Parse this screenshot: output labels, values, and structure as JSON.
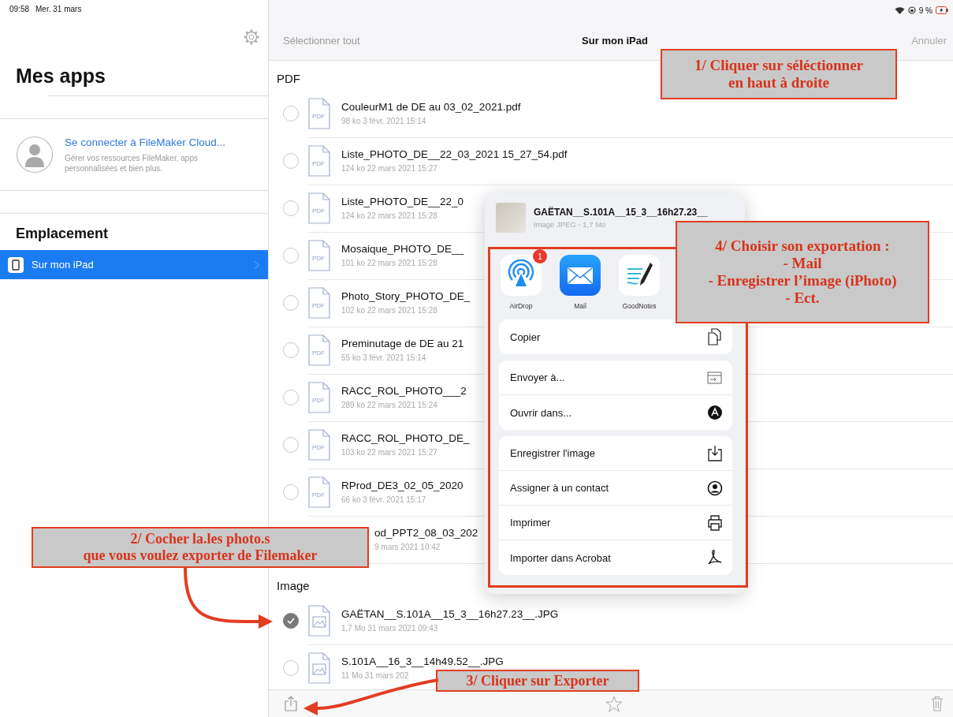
{
  "status_bar": {
    "time": "09:58",
    "date": "Mer. 31 mars",
    "battery": "9 %"
  },
  "sidebar": {
    "title": "Mes apps",
    "account": {
      "link": "Se connecter à FileMaker Cloud...",
      "description": "Gérer vos ressources FileMaker, apps personnalisées et bien plus."
    },
    "section": "Emplacement",
    "items": [
      {
        "label": "Sur mon iPad",
        "selected": true
      }
    ]
  },
  "navbar": {
    "left": "Sélectionner tout",
    "title": "Sur mon iPad",
    "right": "Annuler"
  },
  "sections": [
    {
      "title": "PDF",
      "files": [
        {
          "kind": "pdf",
          "icon_text": "PDF",
          "name": "CouleurM1 de DE au 03_02_2021.pdf",
          "meta": "98 ko 3 févr. 2021 15:14",
          "selected": false
        },
        {
          "kind": "pdf",
          "icon_text": "PDF",
          "name": "Liste_PHOTO_DE__22_03_2021 15_27_54.pdf",
          "meta": "124 ko 22 mars 2021 15:27",
          "selected": false
        },
        {
          "kind": "pdf",
          "icon_text": "PDF",
          "name": "Liste_PHOTO_DE__22_0",
          "meta": "124 ko 22 mars 2021 15:28",
          "selected": false
        },
        {
          "kind": "pdf",
          "icon_text": "PDF",
          "name": "Mosaique_PHOTO_DE__",
          "meta": "101 ko 22 mars 2021 15:28",
          "selected": false
        },
        {
          "kind": "pdf",
          "icon_text": "PDF",
          "name": "Photo_Story_PHOTO_DE_",
          "meta": "102 ko 22 mars 2021 15:28",
          "selected": false
        },
        {
          "kind": "pdf",
          "icon_text": "PDF",
          "name": "Preminutage de DE au 21",
          "meta": "55 ko 3 févr. 2021 15:14",
          "selected": false
        },
        {
          "kind": "pdf",
          "icon_text": "PDF",
          "name": "RACC_ROL_PHOTO___2",
          "meta": "289 ko 22 mars 2021 15:24",
          "selected": false
        },
        {
          "kind": "pdf",
          "icon_text": "PDF",
          "name": "RACC_ROL_PHOTO_DE_",
          "meta": "103 ko 22 mars 2021 15:27",
          "selected": false
        },
        {
          "kind": "pdf",
          "icon_text": "PDF",
          "name": "RProd_DE3_02_05_2020",
          "meta": "66 ko 3 févr. 2021 15:17",
          "selected": false
        },
        {
          "kind": "covered",
          "name": "od_PPT2_08_03_202",
          "meta": "9 mars 2021 10:42"
        }
      ]
    },
    {
      "title": "Image",
      "files": [
        {
          "kind": "image",
          "name": "GAËTAN__S.101A__15_3__16h27.23__.JPG",
          "meta": "1,7 Mo 31 mars 2021 09:43",
          "selected": true
        },
        {
          "kind": "image",
          "name": "S.101A__16_3__14h49.52__.JPG",
          "meta": "11 Mo 31 mars 202",
          "selected": false
        }
      ]
    }
  ],
  "share_sheet": {
    "title": "GAËTAN__S.101A__15_3__16h27.23__",
    "subtitle": "Image JPEG - 1,7 Mo",
    "apps": [
      {
        "kind": "airdrop",
        "label": "AirDrop",
        "badge": "1"
      },
      {
        "kind": "mail",
        "label": "Mail"
      },
      {
        "kind": "goodnotes",
        "label": "GoodNotes"
      }
    ],
    "groups": [
      [
        {
          "kind": "copy",
          "label": "Copier"
        }
      ],
      [
        {
          "kind": "send",
          "label": "Envoyer à..."
        },
        {
          "kind": "open",
          "label": "Ouvrir dans..."
        }
      ],
      [
        {
          "kind": "save",
          "label": "Enregistrer l'image"
        },
        {
          "kind": "contact",
          "label": "Assigner à un contact"
        },
        {
          "kind": "print",
          "label": "Imprimer"
        },
        {
          "kind": "acrobat",
          "label": "Importer dans Acrobat"
        }
      ]
    ]
  },
  "annotations": [
    {
      "kind": "top",
      "lines": [
        "1/ Cliquer sur séléctionner",
        "en haut à droite"
      ]
    },
    {
      "kind": "share",
      "lines": [
        "4/ Choisir son exportation :",
        "- Mail",
        "- Enregistrer l’image (iPhoto)",
        "- Ect."
      ]
    },
    {
      "kind": "check",
      "lines": [
        "2/ Cocher la.les photo.s",
        "que vous voulez exporter de Filemaker"
      ]
    },
    {
      "kind": "export",
      "lines": [
        "3/ Cliquer sur Exporter"
      ]
    }
  ]
}
